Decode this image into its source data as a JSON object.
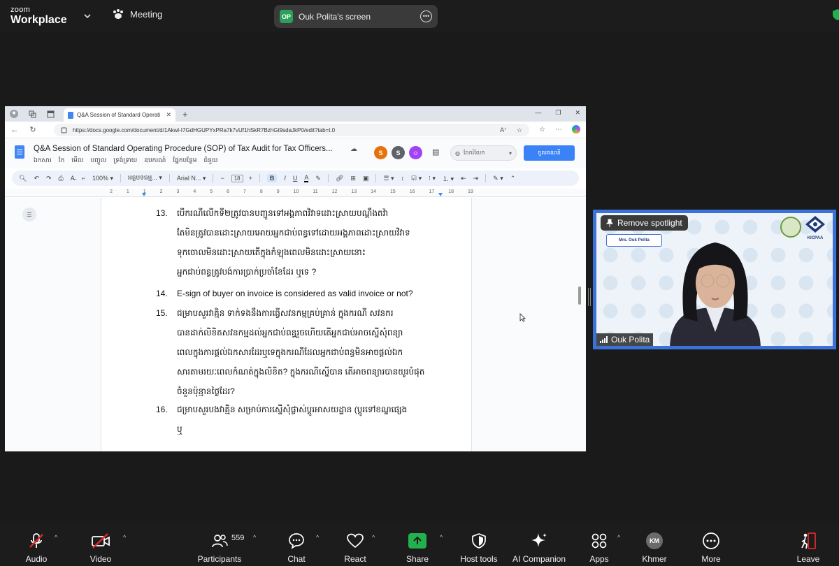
{
  "zoom": {
    "brand_line1": "zoom",
    "brand_line2": "Workplace",
    "meeting_label": "Meeting",
    "screen_avatar": "OP",
    "screen_label": "Ouk Polita's screen",
    "spotlight_button": "Remove spotlight",
    "participant_name": "Ouk Polita",
    "name_card": "Mrs. Ouk Polita",
    "logo_text": "KICPAA",
    "participants_count": "559",
    "controls": [
      {
        "label": "Audio",
        "icon": "mic-muted-icon"
      },
      {
        "label": "Video",
        "icon": "video-off-icon"
      },
      {
        "label": "Participants",
        "icon": "participants-icon"
      },
      {
        "label": "Chat",
        "icon": "chat-icon"
      },
      {
        "label": "React",
        "icon": "heart-icon"
      },
      {
        "label": "Share",
        "icon": "share-arrow-icon"
      },
      {
        "label": "Host tools",
        "icon": "shield-icon"
      },
      {
        "label": "AI Companion",
        "icon": "sparkle-icon"
      },
      {
        "label": "Apps",
        "icon": "apps-icon"
      },
      {
        "label": "Khmer",
        "icon": "km-avatar"
      },
      {
        "label": "More",
        "icon": "more-icon"
      },
      {
        "label": "Leave",
        "icon": "leave-icon"
      }
    ],
    "km_avatar": "KM",
    "accent_green": "#22b14c",
    "spotlight_border": "#3a72d8"
  },
  "browser": {
    "tab_title": "Q&A Session of Standard Operati",
    "url": "https://docs.google.com/document/d/1Akwl-I7GdHGUPYxPRa7k7vUf1hSkR7BzhGt9sdaJkP0/edit?tab=t.0"
  },
  "docs": {
    "title": "Q&A Session of Standard Operating Procedure (SOP) of Tax Audit for Tax Officers...",
    "menu": [
      "ឯកសារ",
      "កែ",
      "មើល",
      "បញ្ចូល",
      "ទ្រង់ទ្រាយ",
      "ឧបករណ៍",
      "ផ្នែកបន្ថែម",
      "ជំនួយ"
    ],
    "collaborators": [
      {
        "initial": "S",
        "color": "#e8710a"
      },
      {
        "initial": "S",
        "color": "#5f6368"
      },
      {
        "initial": "☺",
        "color": "#a142f4"
      }
    ],
    "meet_pill": "ចែករំលែក",
    "share_button": "ចូលគណនី",
    "toolbar": {
      "zoom": "100%",
      "style": "អត្ថបទធម្ម...",
      "font": "Arial N...",
      "size": "18",
      "bold": "B",
      "italic": "I",
      "underline": "U",
      "color": "A"
    },
    "ruler_ticks": [
      "2",
      "1",
      "1",
      "2",
      "3",
      "4",
      "5",
      "6",
      "7",
      "8",
      "9",
      "10",
      "11",
      "12",
      "13",
      "14",
      "15",
      "16",
      "17",
      "18",
      "19"
    ],
    "items": [
      {
        "num": "13.",
        "lines": [
          "បើករណីលើកទី២ត្រូវបានបញ្ជូនទៅអង្គភាពវិវាទដោះស្រាយបណ្តឹងតវ៉ា",
          "តែមិនត្រូវបានដោះស្រាយអោយអ្នកជាប់ពន្ធទៅដោយអង្គភាពដោះស្រាយវិវាទ",
          "ទុកចោលមិនដោះស្រាយតើក្នុងកំឡុងពេលមិនដោះស្រាយនោះ",
          "អ្នកជាប់ពន្ធត្រូវបង់ការប្រាក់ប្រចាំខែដែរ ឬទេ ?"
        ]
      },
      {
        "num": "14.",
        "lines": [
          "E-sign of buyer on invoice is considered as valid invoice or not?"
        ]
      },
      {
        "num": "15.",
        "lines": [
          "ជម្រាបសួរវាគ្មិន ទាក់ទងនឹងការធ្វើសវនកម្មគ្រប់គ្រាន់ ក្នុងករណី សវនករ",
          "បានដាក់លិខិតសវនកម្មដល់អ្នកជាប់ពន្ធរួចហើយតើអ្នកជាប់អាចស្នើសុំពន្យា",
          "ពេលក្នុងការផ្តល់ឯកសារដែរឬទេក្នុងករណីដែលអ្នកជាប់ពន្ធមិនអាចផ្តល់ឯក",
          "សារតាមរយៈពេលកំណត់ក្នុងលិខិត?  ក្នុងករណីស្នើបាន  តើអាចពន្យារបានយូរបំផុត",
          "ចំនួនប៉ុន្មានថ្ងៃដែរ?"
        ]
      },
      {
        "num": "16.",
        "lines": [
          "ជម្រាបសួរបងវាគ្មិន សម្រាប់ការស្នើសុំផ្លាស់ប្តូរអាសយដ្ឋាន (ប្តូរទៅខណ្ឌផ្សេង",
          "ឬ"
        ]
      }
    ]
  }
}
